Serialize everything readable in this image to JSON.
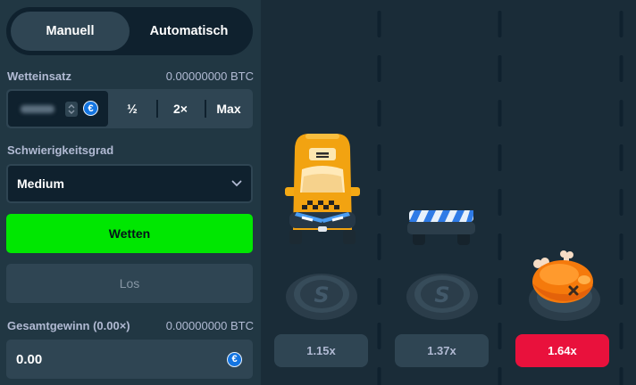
{
  "sidebar": {
    "mode_tabs": {
      "manual": "Manuell",
      "auto": "Automatisch"
    },
    "bet": {
      "label": "Wetteinsatz",
      "balance": "0.00000000 BTC",
      "currency_icon": "€",
      "half": "½",
      "double": "2×",
      "max": "Max"
    },
    "difficulty": {
      "label": "Schwierigkeitsgrad",
      "selected": "Medium"
    },
    "bet_button": "Wetten",
    "go_button": "Los",
    "total_win": {
      "label": "Gesamtgewinn (0.00×)",
      "amount": "0.00000000 BTC",
      "value": "0.00",
      "currency_icon": "€"
    }
  },
  "game": {
    "multipliers": [
      {
        "label": "1.15x",
        "active": false
      },
      {
        "label": "1.37x",
        "active": false
      },
      {
        "label": "1.64x",
        "active": true
      }
    ]
  },
  "colors": {
    "bet_button": "#00e701",
    "active_multiplier": "#e9113c",
    "sidebar_bg": "#213743",
    "game_bg": "#1a2c38"
  }
}
